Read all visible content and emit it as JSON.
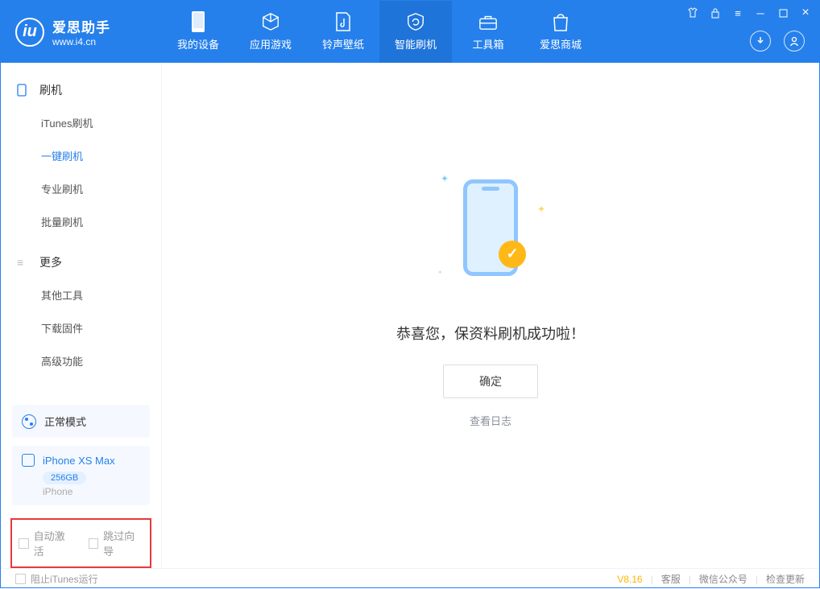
{
  "app": {
    "title": "爱思助手",
    "subtitle": "www.i4.cn"
  },
  "nav": {
    "items": [
      {
        "label": "我的设备"
      },
      {
        "label": "应用游戏"
      },
      {
        "label": "铃声壁纸"
      },
      {
        "label": "智能刷机"
      },
      {
        "label": "工具箱"
      },
      {
        "label": "爱思商城"
      }
    ]
  },
  "sidebar": {
    "group_flash": "刷机",
    "items_flash": [
      {
        "label": "iTunes刷机"
      },
      {
        "label": "一键刷机"
      },
      {
        "label": "专业刷机"
      },
      {
        "label": "批量刷机"
      }
    ],
    "group_more": "更多",
    "items_more": [
      {
        "label": "其他工具"
      },
      {
        "label": "下载固件"
      },
      {
        "label": "高级功能"
      }
    ]
  },
  "device": {
    "mode": "正常模式",
    "name": "iPhone XS Max",
    "capacity": "256GB",
    "type": "iPhone"
  },
  "options": {
    "auto_activate": "自动激活",
    "skip_guide": "跳过向导"
  },
  "main": {
    "success_text": "恭喜您，保资料刷机成功啦！",
    "confirm": "确定",
    "view_log": "查看日志"
  },
  "footer": {
    "block_itunes": "阻止iTunes运行",
    "version": "V8.16",
    "support": "客服",
    "wechat": "微信公众号",
    "check_update": "检查更新"
  }
}
